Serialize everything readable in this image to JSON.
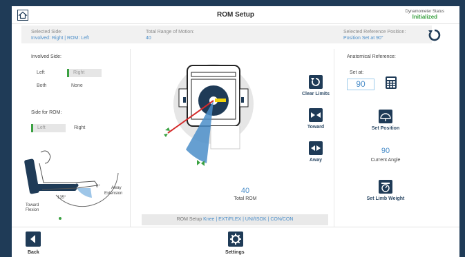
{
  "header": {
    "title": "ROM Setup",
    "dyn_label": "Dynamometer Status",
    "dyn_status": "Initialized"
  },
  "info": {
    "selected_side_label": "Selected Side:",
    "selected_side_value": "Involved: Right | ROM: Left",
    "total_rom_label": "Total Range of Motion:",
    "total_rom_value": "40",
    "ref_label": "Selected Reference Position:",
    "ref_value": "Position Set at 90°"
  },
  "left": {
    "involved_label": "Involved Side:",
    "opt_left": "Left",
    "opt_right": "Right",
    "opt_both": "Both",
    "opt_none": "None",
    "rom_side_label": "Side for ROM:",
    "rom_left": "Left",
    "rom_right": "Right",
    "diagram": {
      "angle": "135°",
      "zero": "0°",
      "away": "Away",
      "extension": "Extension",
      "toward": "Toward",
      "flexion": "Flexion",
      "start_note": "= Start Position"
    }
  },
  "center": {
    "clear_limits": "Clear Limits",
    "toward": "Toward",
    "away": "Away",
    "total_rom_value": "40",
    "total_rom_label": "Total ROM",
    "setup_prefix": "ROM Setup",
    "setup_value": "Knee | EXT/FLEX | UNI/ISOK | CON/CON"
  },
  "right": {
    "anat_label": "Anatomical Reference:",
    "set_at_label": "Set at:",
    "set_at_value": "90",
    "set_position": "Set Position",
    "current_angle_value": "90",
    "current_angle_label": "Current Angle",
    "set_limb_weight": "Set Limb Weight"
  },
  "footer": {
    "back": "Back",
    "settings": "Settings"
  },
  "colors": {
    "navy": "#1f3b57",
    "accent_blue": "#4b8ec9",
    "green": "#3aa141",
    "red": "#d42b2b",
    "yellow": "#f2d40c"
  }
}
